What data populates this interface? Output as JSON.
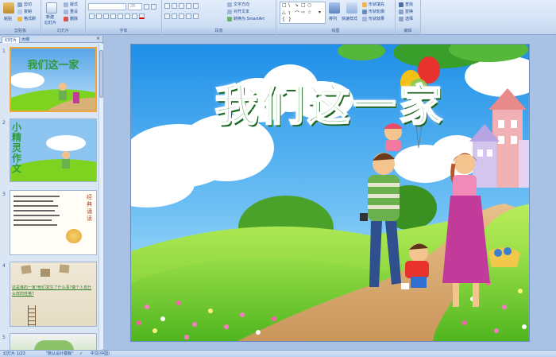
{
  "ribbon": {
    "clipboard": {
      "paste": "粘贴",
      "cut": "剪切",
      "copy": "复制",
      "format_painter": "格式刷",
      "label": "剪贴板"
    },
    "slides": {
      "new_slide": "新建",
      "new_slide_2": "幻灯片",
      "layout": "版式",
      "reset": "重设",
      "delete": "删除",
      "label": "幻灯片"
    },
    "font": {
      "font_name": "",
      "font_size": "28",
      "label": "字体"
    },
    "paragraph": {
      "text_direction": "文字方向",
      "align_text": "对齐文本",
      "smartart": "转换为 SmartArt",
      "label": "段落"
    },
    "drawing": {
      "arrange": "排列",
      "quick_styles": "快速样式",
      "shape_fill": "形状填充",
      "shape_outline": "形状轮廓",
      "shape_effects": "形状效果",
      "label": "绘图"
    },
    "editing": {
      "find": "查找",
      "replace": "替换",
      "select": "选择",
      "label": "编辑"
    }
  },
  "left_panel": {
    "tab_slides": "幻灯片",
    "tab_outline": "大纲",
    "close": "×",
    "slides": [
      {
        "num": "1",
        "title": "我们这一家"
      },
      {
        "num": "2",
        "title": "小精灵作文"
      },
      {
        "num": "3",
        "side_title": "经典诵读"
      },
      {
        "num": "4",
        "text": "这是谁的一家?他们发生了什么事?做个人有什么样的性格?"
      },
      {
        "num": "5"
      }
    ]
  },
  "slide": {
    "title": "我们这一家"
  },
  "statusbar": {
    "slide_info": "幻灯片 1/23",
    "theme": "\"默认设计模板\"",
    "language": "中文(中国)"
  },
  "colors": {
    "accent": "#f2a638",
    "ribbon": "#d5e3f6",
    "title_green": "#2f9a3a"
  }
}
